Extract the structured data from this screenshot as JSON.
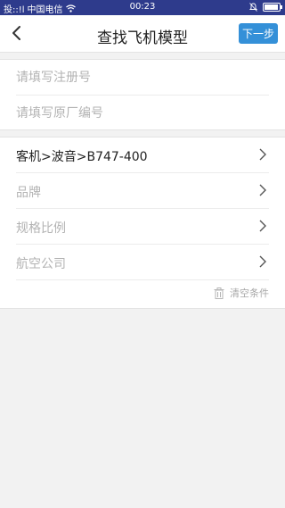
{
  "status_bar": {
    "signal": "投::!l",
    "carrier": "中国电信",
    "time": "00:23"
  },
  "nav": {
    "title": "查找飞机模型",
    "next_label": "下一步"
  },
  "inputs": {
    "registration_placeholder": "请填写注册号",
    "factory_number_placeholder": "请填写原厂编号"
  },
  "selectors": [
    {
      "label": "客机>波音>B747-400",
      "is_placeholder": false
    },
    {
      "label": "品牌",
      "is_placeholder": true
    },
    {
      "label": "规格比例",
      "is_placeholder": true
    },
    {
      "label": "航空公司",
      "is_placeholder": true
    }
  ],
  "clear_label": "清空条件",
  "icons": {
    "back": "back-arrow-icon",
    "chevron": "chevron-right-icon",
    "trash": "trash-icon",
    "wifi": "wifi-icon",
    "battery": "battery-icon",
    "bell_off": "bell-off-icon"
  },
  "colors": {
    "status_bar": "#2e3b8c",
    "accent": "#3490d8",
    "placeholder_text": "#b3b3b3"
  }
}
